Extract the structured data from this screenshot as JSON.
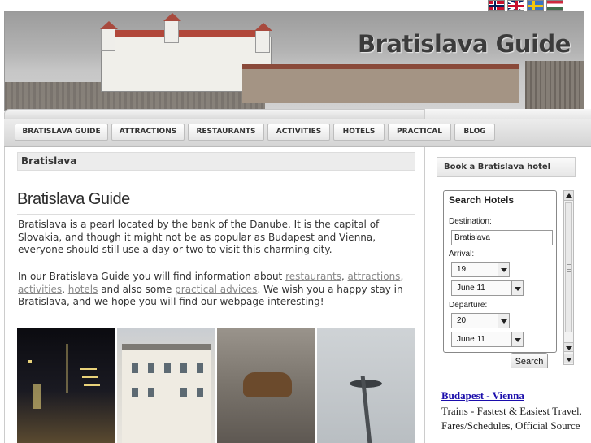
{
  "languages": [
    "Norsk",
    "English",
    "Svenska",
    "Magyar"
  ],
  "header": {
    "title": "Bratislava Guide"
  },
  "nav": {
    "items": [
      {
        "label": "BRATISLAVA GUIDE"
      },
      {
        "label": "ATTRACTIONS"
      },
      {
        "label": "RESTAURANTS"
      },
      {
        "label": "ACTIVITIES"
      },
      {
        "label": "HOTELS"
      },
      {
        "label": "PRACTICAL"
      },
      {
        "label": "BLOG"
      }
    ]
  },
  "main": {
    "breadcrumb": "Bratislava",
    "title": "Bratislava Guide",
    "intro": "Bratislava is a pearl located by the bank of the Danube. It is the capital of Slovakia, and though it might not be as popular as Budapest and Vienna, everyone should still use a day or two to visit this charming city.",
    "p2_start": "In our Bratislava Guide you will find information about ",
    "links": {
      "restaurants": "restaurants",
      "attractions": "attractions",
      "activities": "activities",
      "hotels": "hotels",
      "practical": "practical advices"
    },
    "p2_sep1": ", ",
    "p2_sep2": ", ",
    "p2_sep3": ", ",
    "p2_mid": " and also some ",
    "p2_end": ". We wish you a happy stay in Bratislava, and we hope you will find our webpage interesting!"
  },
  "sidebar": {
    "book_title": "Book a Bratislava hotel",
    "search": {
      "title": "Search Hotels",
      "destination_label": "Destination:",
      "destination_value": "Bratislava",
      "arrival_label": "Arrival:",
      "arrival_day": "19",
      "arrival_month": "June 11",
      "departure_label": "Departure:",
      "departure_day": "20",
      "departure_month": "June 11",
      "button": "Search"
    },
    "ad": {
      "link": "Budapest - Vienna",
      "text": "Trains - Fastest & Easiest Travel. Fares/Schedules, Official Source"
    }
  },
  "colors": {
    "link": "#1a0dab",
    "muted_link": "#888888",
    "title": "#3b3b3b"
  }
}
